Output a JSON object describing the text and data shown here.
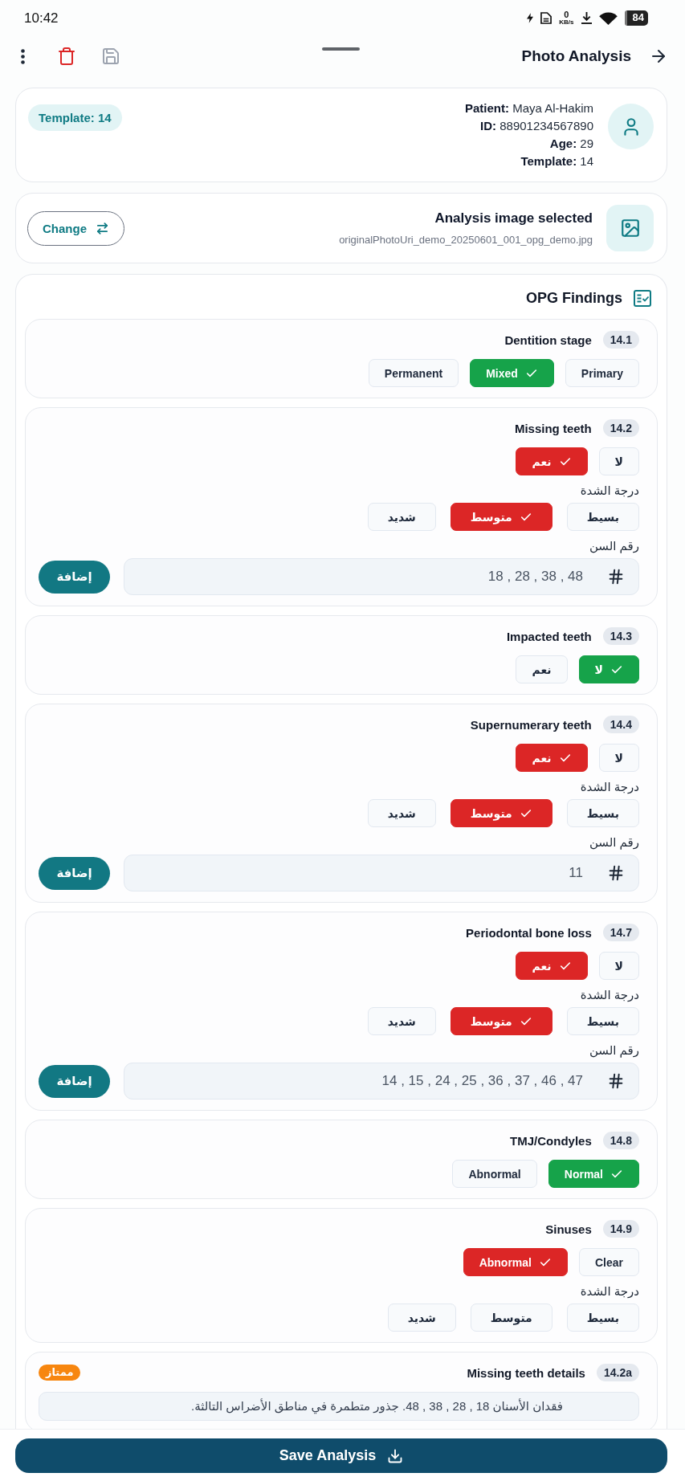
{
  "status_bar": {
    "time": "10:42",
    "speed_value": "0",
    "speed_unit": "KB/s",
    "battery": "84"
  },
  "toolbar": {
    "title": "Photo Analysis",
    "save_disabled": true
  },
  "patient": {
    "template_badge": "Template: 14",
    "details": [
      "**Patient:** Maya Al-Hakim",
      "**ID:** 88901234567890",
      "**Age:** 29",
      "**Template:** 14"
    ]
  },
  "image": {
    "change_button": "Change",
    "title": "Analysis image selected",
    "filename": "originalPhotoUri_demo_20250601_001_opg_demo.jpg"
  },
  "findings": {
    "title": "OPG Findings",
    "items": [
      {
        "title": "Dentition stage",
        "code": "14.1",
        "groups": [
          {
            "kind": "options",
            "color": "#16a34a",
            "options": [
              {
                "label": "Primary",
                "selected": false
              },
              {
                "label": "Mixed",
                "selected": true
              },
              {
                "label": "Permanent",
                "selected": false
              }
            ]
          }
        ]
      },
      {
        "title": "Missing teeth",
        "code": "14.2",
        "groups": [
          {
            "kind": "options",
            "color": "#dc2626",
            "options": [
              {
                "label": "لا",
                "selected": false
              },
              {
                "label": "نعم",
                "selected": true
              }
            ]
          },
          {
            "kind": "scale",
            "label": "درجة الشدة",
            "color": "#dc2626",
            "options": [
              {
                "label": "بسيط",
                "selected": false
              },
              {
                "label": "متوسط",
                "selected": true
              },
              {
                "label": "شديد",
                "selected": false
              }
            ]
          },
          {
            "kind": "teeth",
            "label": "رقم السن",
            "value": "18 , 28 , 38 , 48",
            "button": "إضافة"
          }
        ]
      },
      {
        "title": "Impacted teeth",
        "code": "14.3",
        "groups": [
          {
            "kind": "options",
            "color": "#16a34a",
            "options": [
              {
                "label": "لا",
                "selected": true
              },
              {
                "label": "نعم",
                "selected": false
              }
            ]
          }
        ]
      },
      {
        "title": "Supernumerary teeth",
        "code": "14.4",
        "groups": [
          {
            "kind": "options",
            "color": "#dc2626",
            "options": [
              {
                "label": "لا",
                "selected": false
              },
              {
                "label": "نعم",
                "selected": true
              }
            ]
          },
          {
            "kind": "scale",
            "label": "درجة الشدة",
            "color": "#dc2626",
            "options": [
              {
                "label": "بسيط",
                "selected": false
              },
              {
                "label": "متوسط",
                "selected": true
              },
              {
                "label": "شديد",
                "selected": false
              }
            ]
          },
          {
            "kind": "teeth",
            "label": "رقم السن",
            "value": "11",
            "button": "إضافة"
          }
        ]
      },
      {
        "title": "Periodontal bone loss",
        "code": "14.7",
        "groups": [
          {
            "kind": "options",
            "color": "#dc2626",
            "options": [
              {
                "label": "لا",
                "selected": false
              },
              {
                "label": "نعم",
                "selected": true
              }
            ]
          },
          {
            "kind": "scale",
            "label": "درجة الشدة",
            "color": "#dc2626",
            "options": [
              {
                "label": "بسيط",
                "selected": false
              },
              {
                "label": "متوسط",
                "selected": true
              },
              {
                "label": "شديد",
                "selected": false
              }
            ]
          },
          {
            "kind": "teeth",
            "label": "رقم السن",
            "value": "14 , 15 , 24 , 25 , 36 , 37 , 46 , 47",
            "button": "إضافة"
          }
        ]
      },
      {
        "title": "TMJ/Condyles",
        "code": "14.8",
        "groups": [
          {
            "kind": "options",
            "color": "#16a34a",
            "options": [
              {
                "label": "Normal",
                "selected": true
              },
              {
                "label": "Abnormal",
                "selected": false
              }
            ]
          }
        ]
      },
      {
        "title": "Sinuses",
        "code": "14.9",
        "groups": [
          {
            "kind": "options",
            "color": "#dc2626",
            "options": [
              {
                "label": "Clear",
                "selected": false
              },
              {
                "label": "Abnormal",
                "selected": true
              }
            ]
          },
          {
            "kind": "scale",
            "label": "درجة الشدة",
            "options": [
              {
                "label": "بسيط",
                "selected": false
              },
              {
                "label": "متوسط",
                "selected": false
              },
              {
                "label": "شديد",
                "selected": false
              }
            ]
          }
        ]
      },
      {
        "title": "Missing teeth details",
        "code": "14.2a",
        "rating": "ممتاز",
        "groups": [
          {
            "kind": "note",
            "value": "فقدان الأسنان 18 , 28 , 38 , 48. جذور متطمرة في مناطق الأضراس التالثة."
          }
        ]
      }
    ]
  },
  "save_button": "Save Analysis"
}
